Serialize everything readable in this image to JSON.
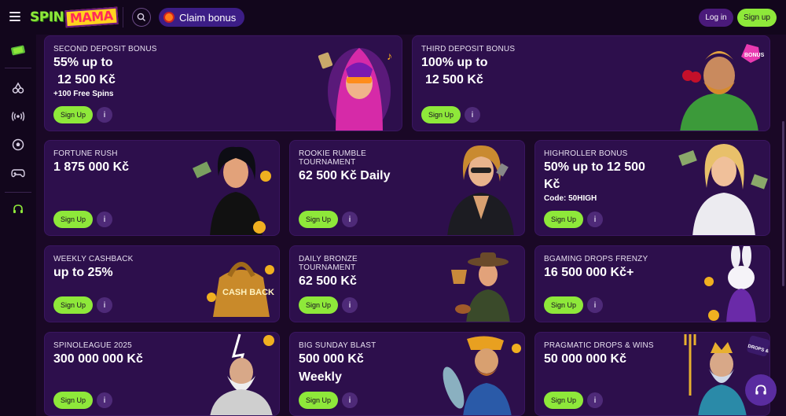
{
  "header": {
    "logo_spin": "SPIN",
    "logo_mama": "MAMA",
    "claim_label": "Claim bonus",
    "login_label": "Log in",
    "signup_label": "Sign up"
  },
  "sidebar": {
    "items": [
      {
        "name": "promo-icon"
      },
      {
        "name": "cherry-icon"
      },
      {
        "name": "live-icon"
      },
      {
        "name": "football-icon"
      },
      {
        "name": "gamepad-icon"
      },
      {
        "name": "headset-icon"
      }
    ]
  },
  "cards": [
    {
      "id": "second-deposit",
      "title": "SECOND DEPOSIT BONUS",
      "headline1": "55% up to",
      "headline2": "12 500 Kč",
      "sub": "+100 Free Spins",
      "cta": "Sign Up"
    },
    {
      "id": "third-deposit",
      "title": "THIRD DEPOSIT BONUS",
      "headline1": "100% up to",
      "headline2": "12 500 Kč",
      "cta": "Sign Up"
    },
    {
      "id": "fortune-rush",
      "title": "FORTUNE RUSH",
      "headline1": "1 875 000 Kč",
      "cta": "Sign Up"
    },
    {
      "id": "rookie-rumble",
      "title": "ROOKIE RUMBLE",
      "title2": "TOURNAMENT",
      "headline1": "62 500 Kč Daily",
      "cta": "Sign Up"
    },
    {
      "id": "highroller",
      "title": "HIGHROLLER BONUS",
      "headline1": "50% up to 12 500",
      "headline2": "Kč",
      "sub": "Code: 50HIGH",
      "cta": "Sign Up"
    },
    {
      "id": "weekly-cashback",
      "title": "WEEKLY CASHBACK",
      "headline1": "up to 25%",
      "cta": "Sign Up",
      "art_text": "CASH BACK"
    },
    {
      "id": "daily-bronze",
      "title": "DAILY BRONZE",
      "title2": "TOURNAMENT",
      "headline1": "62 500 Kč",
      "cta": "Sign Up"
    },
    {
      "id": "bgaming-drops",
      "title": "BGAMING DROPS FRENZY",
      "headline1": "16 500 000 Kč+",
      "cta": "Sign Up"
    },
    {
      "id": "spinoleague",
      "title": "SPINOLEAGUE 2025",
      "headline1": "300 000 000 Kč",
      "cta": "Sign Up"
    },
    {
      "id": "big-sunday",
      "title": "BIG SUNDAY BLAST",
      "headline1": "500 000 Kč",
      "headline2": "Weekly",
      "cta": "Sign Up"
    },
    {
      "id": "pragmatic-drops",
      "title": "PRAGMATIC DROPS & WINS",
      "headline1": "50 000 000 Kč",
      "cta": "Sign Up",
      "art_text": "DROPS & WINS"
    }
  ],
  "colors": {
    "accent_green": "#8ee83a",
    "card_bg": "#2d0f4c",
    "page_bg": "#1a0826",
    "claim_bg": "#3c1d86"
  }
}
